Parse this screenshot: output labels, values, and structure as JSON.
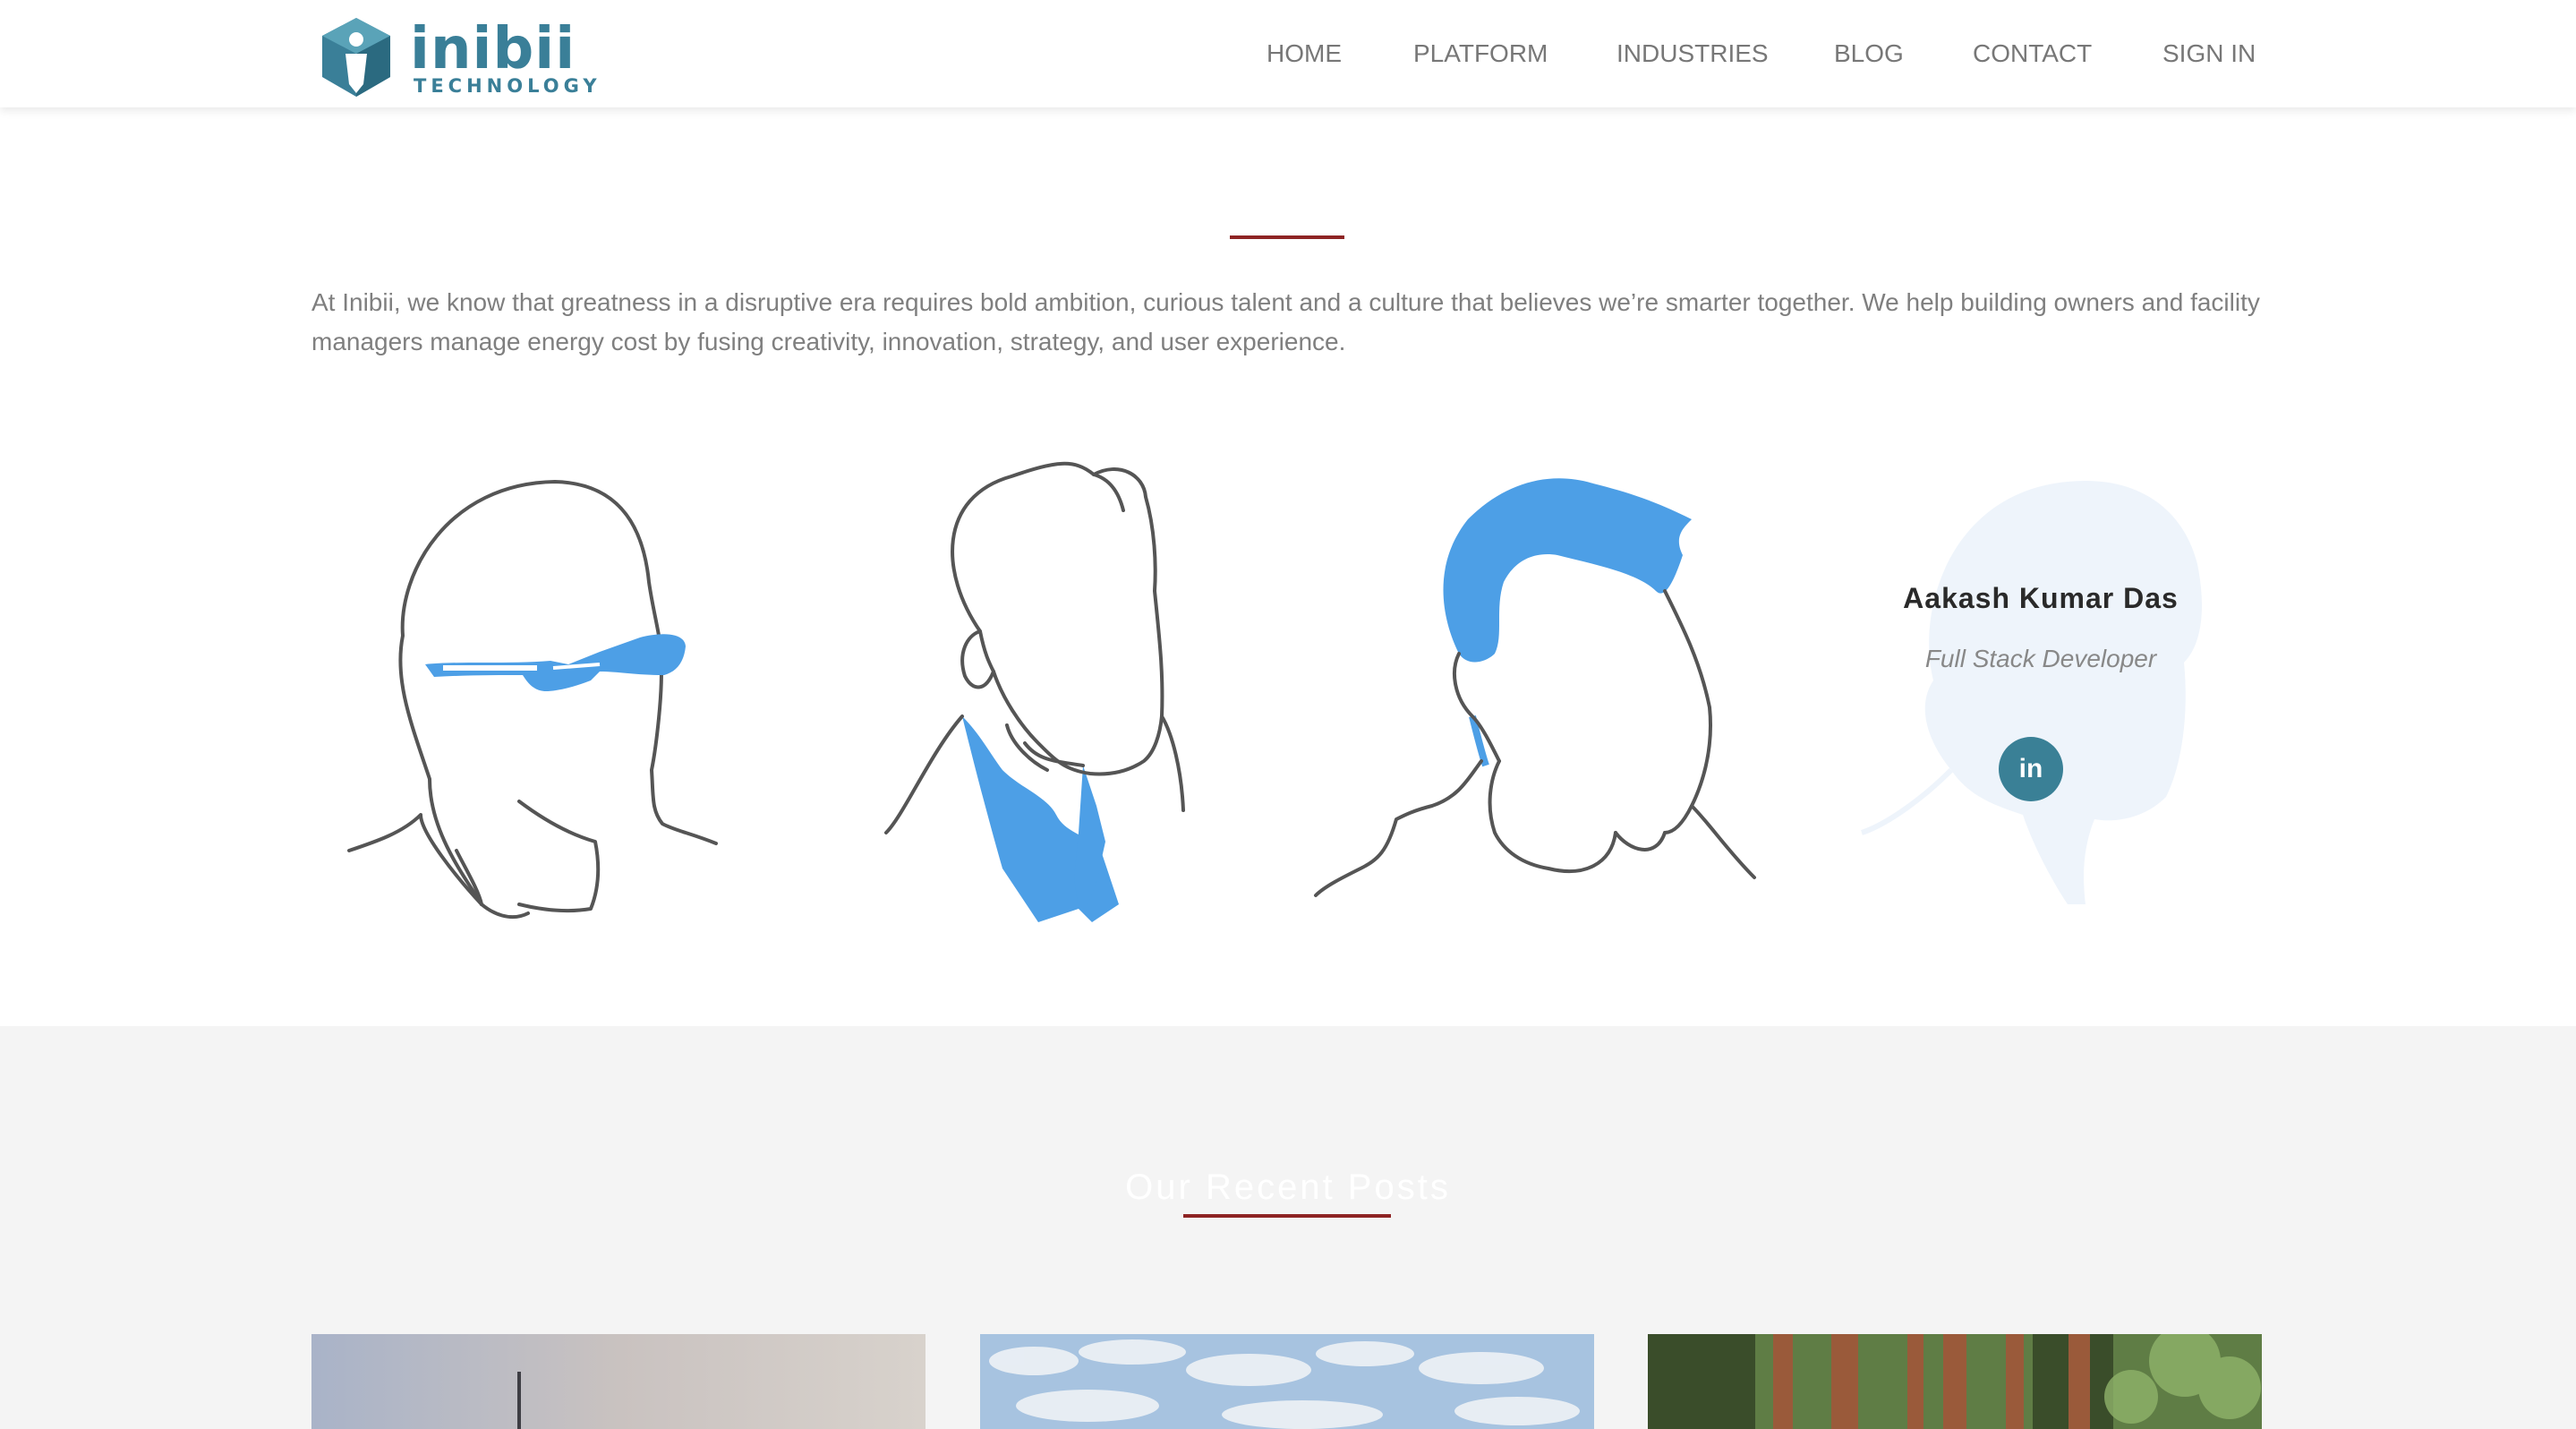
{
  "brand": {
    "name": "inibii",
    "tagline": "TECHNOLOGY"
  },
  "nav": {
    "items": [
      {
        "label": "HOME"
      },
      {
        "label": "PLATFORM"
      },
      {
        "label": "INDUSTRIES"
      },
      {
        "label": "BLOG"
      },
      {
        "label": "CONTACT"
      },
      {
        "label": "SIGN IN"
      }
    ]
  },
  "about": {
    "intro": "At Inibii, we know that greatness in a disruptive era requires bold ambition, curious talent and a culture that believes we’re smarter together. We help building owners and facility managers manage energy cost by fusing creativity, innovation, strategy, and user experience."
  },
  "team": {
    "featured": {
      "name": "Aakash Kumar Das",
      "role": "Full Stack Developer",
      "social": "in"
    }
  },
  "posts": {
    "title": "Our Recent Posts"
  },
  "colors": {
    "accent": "#8e2424",
    "brand": "#3a7f98",
    "illustration": "#4d9fe6",
    "linkedin": "#3a8096"
  }
}
